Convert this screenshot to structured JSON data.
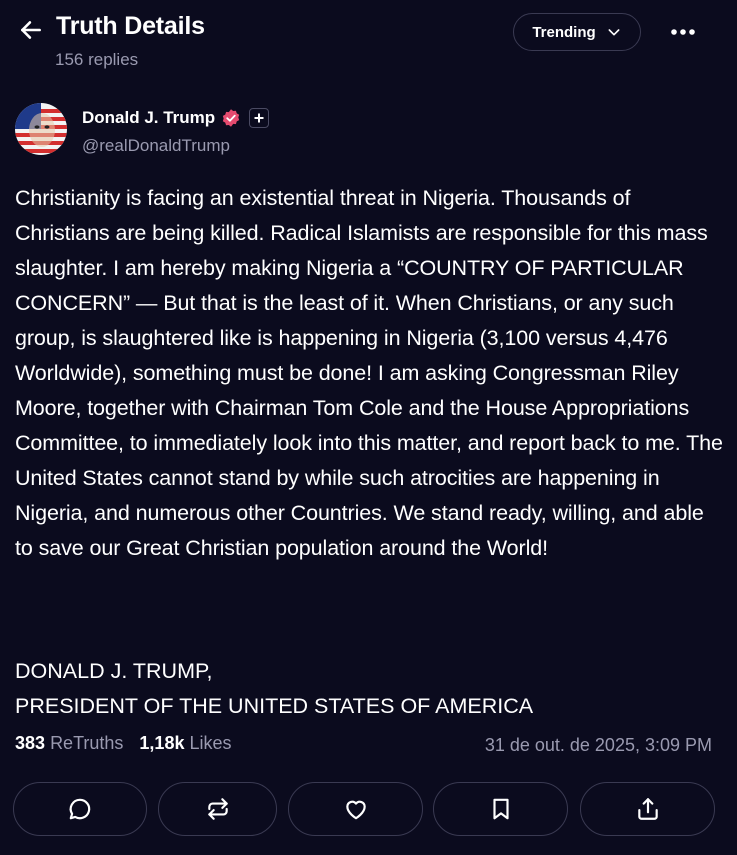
{
  "header": {
    "title": "Truth Details",
    "replies": "156 replies",
    "sort_label": "Trending",
    "back_icon": "arrow-left-icon",
    "more_icon": "more-horizontal-icon"
  },
  "post": {
    "author_name": "Donald J. Trump",
    "handle": "@realDonaldTrump",
    "verified_color": "#e54b6f",
    "paragraph": "Christianity is facing an existential threat in Nigeria. Thousands of Christians are being killed. Radical Islamists are responsible for this mass slaughter. I am hereby making Nigeria a “COUNTRY OF PARTICULAR CONCERN” — But that is the least of it. When Christians, or any such group, is slaughtered like is happening in Nigeria (3,100 versus 4,476 Worldwide), something must be done! I am asking Congressman Riley Moore, together with Chairman Tom Cole and the House Appropriations Committee, to immediately look into this matter, and report back to me. The United States cannot stand by while such atrocities are happening in Nigeria, and numerous other Countries. We stand ready, willing, and able to save our Great Christian population around the World!",
    "signature_line1": "DONALD J. TRUMP,",
    "signature_line2": "PRESIDENT OF THE UNITED STATES OF AMERICA"
  },
  "stats": {
    "retruths_count": "383",
    "retruths_label": "ReTruths",
    "likes_count": "1,18k",
    "likes_label": "Likes",
    "timestamp": "31 de out. de 2025, 3:09 PM"
  },
  "actions": [
    {
      "icon": "comment-icon"
    },
    {
      "icon": "retruth-icon"
    },
    {
      "icon": "heart-icon"
    },
    {
      "icon": "bookmark-icon"
    },
    {
      "icon": "share-icon"
    }
  ]
}
